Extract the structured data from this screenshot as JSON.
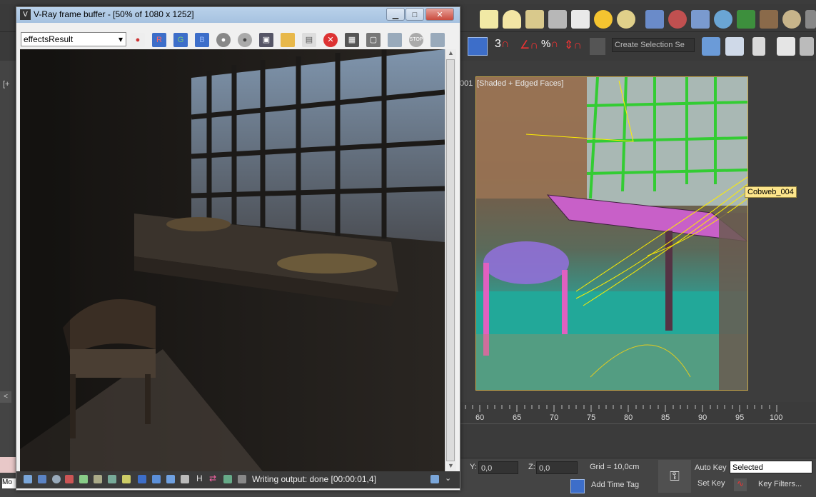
{
  "vfb": {
    "title": "V-Ray frame buffer - [50% of 1080 x 1252]",
    "channel": "effectsResult",
    "btn_r": "R",
    "btn_g": "G",
    "btn_b": "B",
    "minimize": "▁",
    "maximize": "□",
    "close": "✕",
    "status_text": "Writing output: done [00:00:01,4]"
  },
  "max": {
    "toolbar_num_a": "3",
    "toolbar_pct": "%",
    "selection_set_placeholder": "Create Selection Se",
    "viewport_label": "[Shaded + Edged Faces]",
    "viewport_label_prefix": "001",
    "object_tag": "Cobweb_004",
    "left_plus": "[+",
    "timeline_ticks": [
      "60",
      "65",
      "70",
      "75",
      "80",
      "85",
      "90",
      "95",
      "100"
    ],
    "y_label": "Y:",
    "y_value": "0,0",
    "z_label": "Z:",
    "z_value": "0,0",
    "grid": "Grid = 10,0cm",
    "add_time_tag": "Add Time Tag",
    "auto_key": "Auto Key",
    "set_key": "Set Key",
    "selected": "Selected",
    "key_filters": "Key Filters...",
    "bottom_left": "Mo"
  },
  "colors": {
    "accent_r": "#d9534f",
    "accent_g": "#3c8a3c",
    "accent_b": "#3d6ec9",
    "viewport_border": "#c9a94b",
    "tag_bg": "#fde58b"
  }
}
